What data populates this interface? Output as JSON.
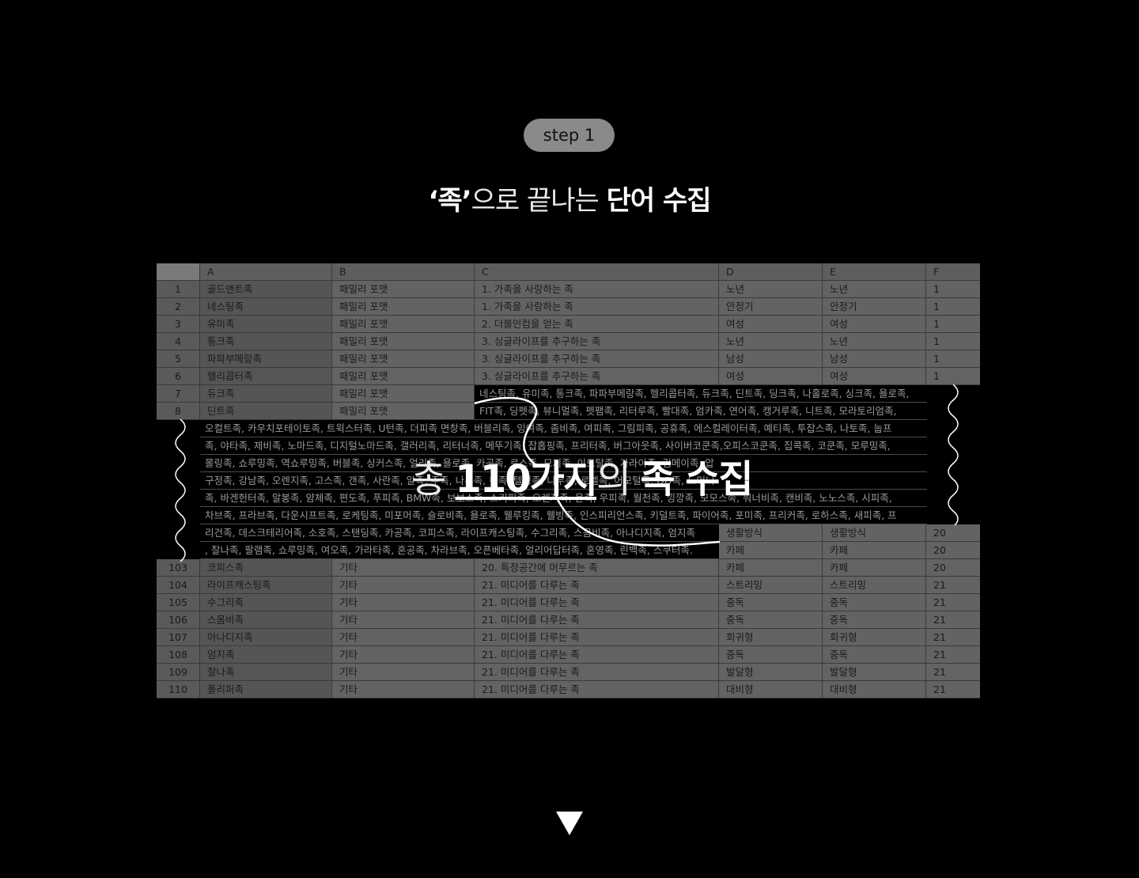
{
  "badge": "step 1",
  "headline": {
    "q_word": "‘족’",
    "mid": "으로 끝나는 ",
    "bold": "단어 수집"
  },
  "columns": [
    "",
    "A",
    "B",
    "C",
    "D",
    "E",
    "F"
  ],
  "top_rows": [
    [
      "1",
      "골드앤트족",
      "패밀리 포맷",
      "1. 가족을 사랑하는 족",
      "노년",
      "노년",
      "1"
    ],
    [
      "2",
      "네스팅족",
      "패밀리 포맷",
      "1. 가족을 사랑하는 족",
      "안정기",
      "안정기",
      "1"
    ],
    [
      "3",
      "유미족",
      "패밀리 포맷",
      "2. 더블인컴을 얻는 족",
      "여성",
      "여성",
      "1"
    ],
    [
      "4",
      "통크족",
      "패밀리 포맷",
      "3. 싱글라이프를 추구하는 족",
      "노년",
      "노년",
      "1"
    ],
    [
      "5",
      "파파부메랑족",
      "패밀리 포맷",
      "3. 싱글라이프를 추구하는 족",
      "남성",
      "남성",
      "1"
    ],
    [
      "6",
      "헬리콥터족",
      "패밀리 포맷",
      "3. 싱글라이프를 추구하는 족",
      "여성",
      "여성",
      "1"
    ]
  ],
  "partial_rows": [
    [
      "7",
      "듀크족",
      "패밀리 포맷"
    ],
    [
      "8",
      "딘트족",
      "패밀리 포맷"
    ]
  ],
  "band_lines": [
    "네스팅족, 유미족, 통크족, 파파부메랑족, 헬리콥터족, 듀크족, 딘트족, 딩크족, 나홀로족, 싱크족, 욜로족,",
    "FIT족, 딩펫족, 뷰니멀족, 펫팸족, 리터루족, 빨대족, 엄카족, 연어족, 캥거루족, 니트족, 모라토리엄족,",
    "오컬트족, 카우치포테이토족, 트윅스터족, U턴족, 더피족 면창족, 버블리족, 잉여족, 좀비족, 여피족, 그림피족, 공휴족, 에스컬레이터족, 예티족, 투잡스족, 나토족, 눕프",
    "족, 야타족, 제비족, 노마드족, 디지털노마드족, 갤러리족, 리터너족, 메뚜기족, 잡홉핑족, 프리터족, 버그아웃족, 사이버코쿤족,오피스코쿤족, 집콕족, 코쿤족, 모루밍족,",
    "몰링족, 쇼루밍족, 역쇼루밍족, 버블족, 싱커스족, 얼리족, 욜로족, 카공족, 로스족, 모지족, 이모탈족, 가라이족, 김메이족, 압",
    "구정족, 강남족, 오렌지족, 고스족, 갠족, 사란족, 알족, 주족, 나루족, 캥족, 텔링족, 나우족, 로엘족, 어모털족, DD족, 노머니",
    "족, 바겐헌터족, 알봉족, 얌체족, 편도족, 푸피족, BMW족, 보보스족, 스키피족, 오렌지족, 윤족, 우피족, 월천족, 낑깡족, 모모스족, 워너비족, 캔비족, 노노스족, 시피족,",
    "차브족, 프라브족, 다운시프트족, 로케팅족, 미포머족, 슬로비족, 욜로족, 웰루킹족, 웰빙족, 인스피리언스족, 키덜트족, 파이어족, 포미족, 프리커족, 로하스족, 새피족, 프",
    "리건족, 데스크테리어족, 소호족, 스탠딩족, 카공족, 코피스족, 라이프캐스팅족, 수그리족, 스몸비족, 아나디지족, 엄지족",
    ", 찰나족, 팔램족, 쇼루밍족, 여오족, 가라타족, 혼공족, 차라브족, 오픈베타족, 얼리어답터족, 혼영족, 린백족, 스쿠터족."
  ],
  "side_rows": [
    [
      "생활방식",
      "생활방식",
      "20"
    ],
    [
      "카페",
      "카페",
      "20"
    ]
  ],
  "bottom_rows": [
    [
      "103",
      "코피스족",
      "기타",
      "20. 특정공간에 머무르는 족",
      "카페",
      "카페",
      "20"
    ],
    [
      "104",
      "라이프캐스팅족",
      "기타",
      "21. 미디어를 다루는 족",
      "스트리밍",
      "스트리밍",
      "21"
    ],
    [
      "105",
      "수그리족",
      "기타",
      "21. 미디어를 다루는 족",
      "중독",
      "중독",
      "21"
    ],
    [
      "106",
      "스몸비족",
      "기타",
      "21. 미디어를 다루는 족",
      "중독",
      "중독",
      "21"
    ],
    [
      "107",
      "아나디지족",
      "기타",
      "21. 미디어를 다루는 족",
      "회귀형",
      "회귀형",
      "21"
    ],
    [
      "108",
      "엄지족",
      "기타",
      "21. 미디어를 다루는 족",
      "중독",
      "중독",
      "21"
    ],
    [
      "109",
      "찰나족",
      "기타",
      "21. 미디어를 다루는 족",
      "발달형",
      "발달형",
      "21"
    ],
    [
      "110",
      "폴리퍼족",
      "기타",
      "21. 미디어를 다루는 족",
      "대비형",
      "대비형",
      "21"
    ]
  ],
  "overlay": {
    "prefix": "총 ",
    "count": "110가지",
    "mid": "의 ",
    "bold": "족 수집"
  }
}
